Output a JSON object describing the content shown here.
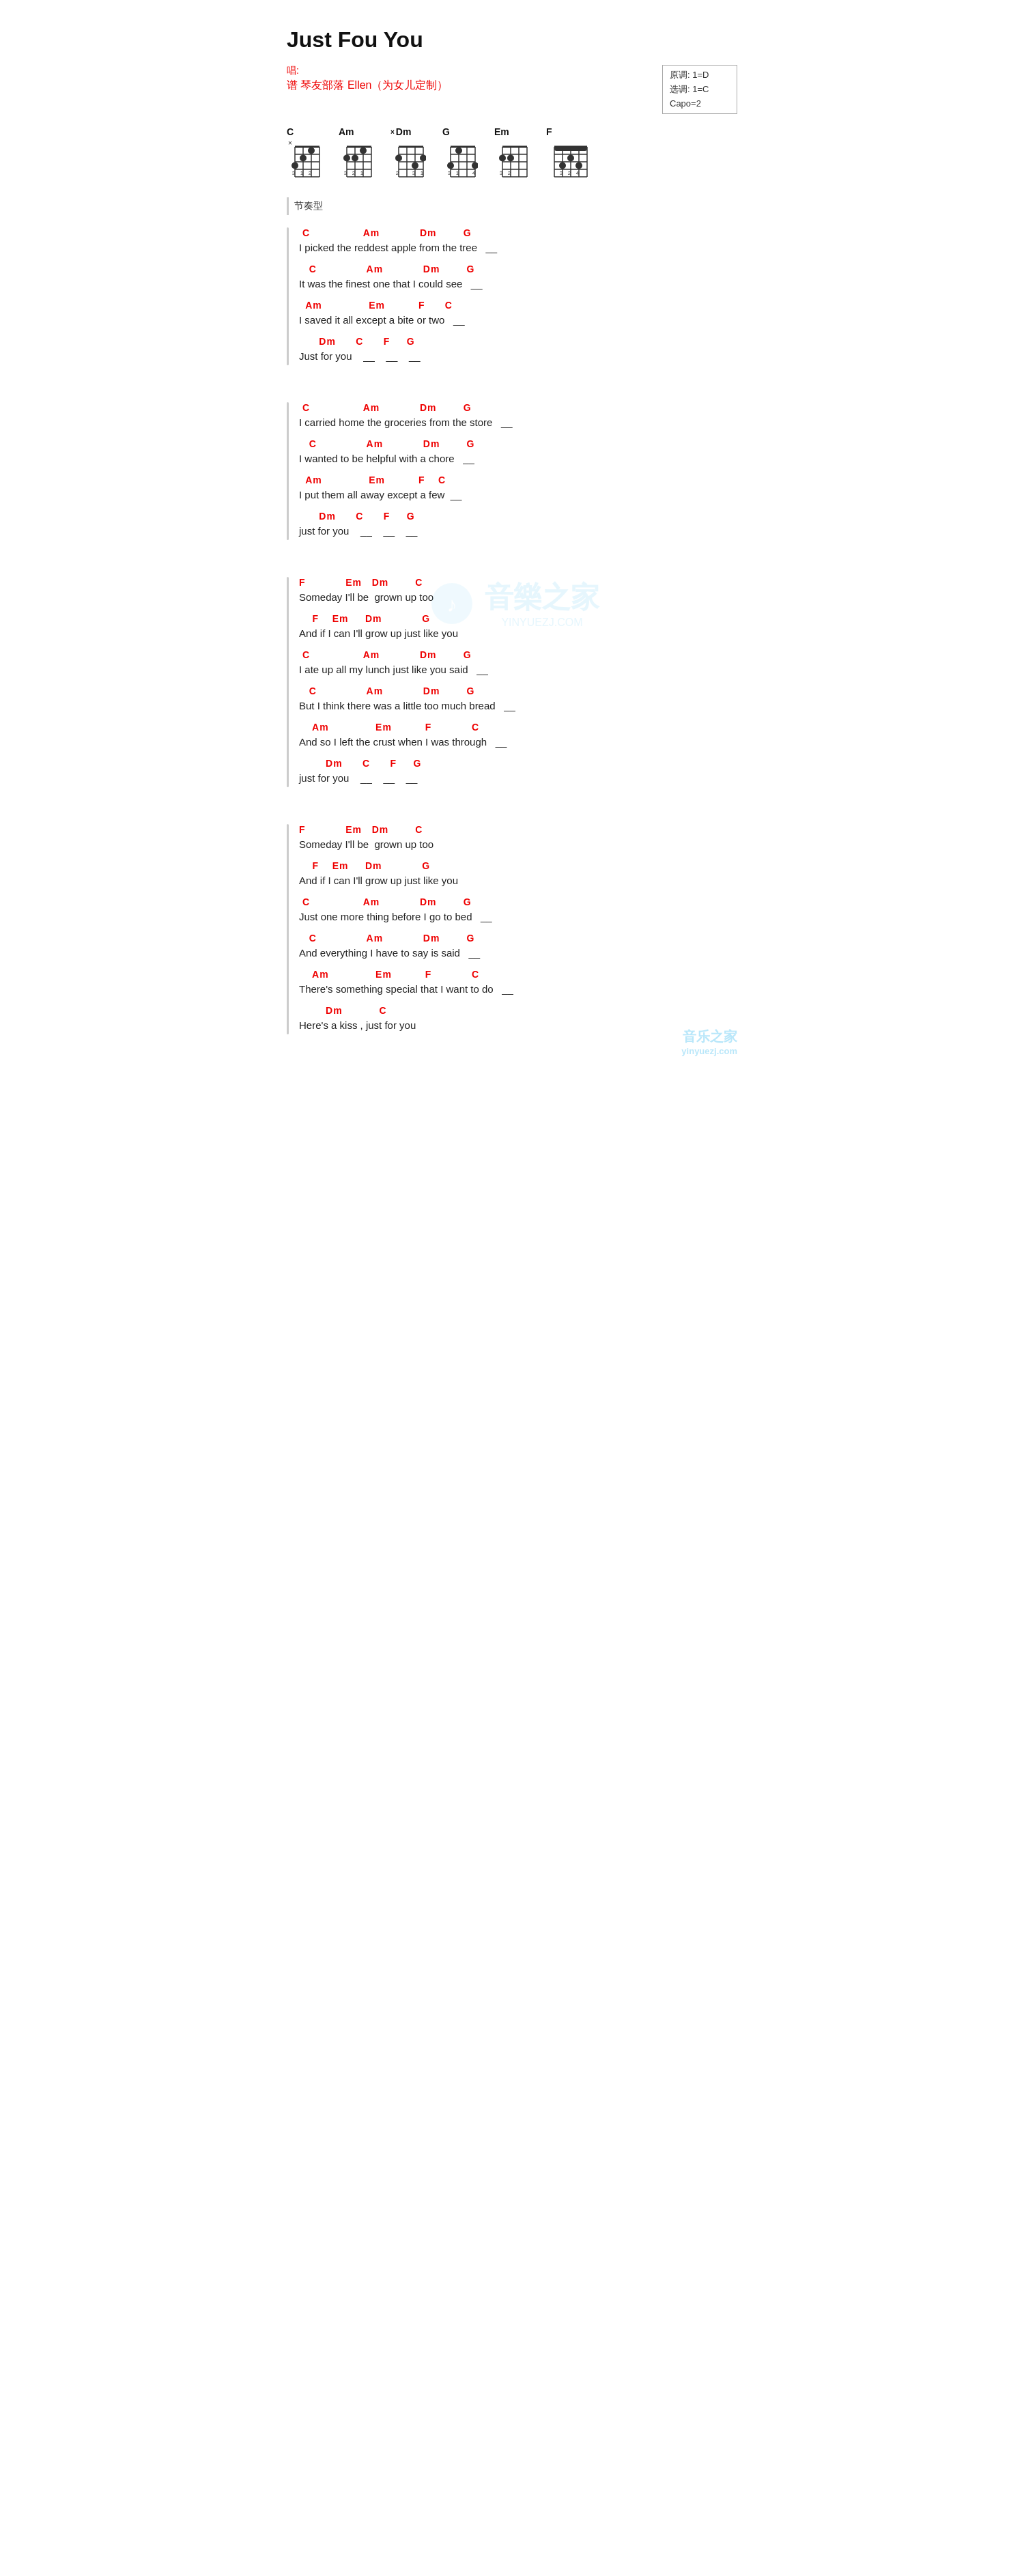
{
  "title": "Just Fou You",
  "meta": {
    "sing_label": "唱:",
    "composer_label": "谱",
    "composer": "琴友部落 Ellen（为女儿定制）",
    "original_key": "原调: 1=D",
    "selected_key": "选调: 1=C",
    "capo": "Capo=2"
  },
  "chords": [
    {
      "name": "C",
      "x_marker": true
    },
    {
      "name": "Am",
      "x_marker": false
    },
    {
      "name": "Dm",
      "x_marker": true
    },
    {
      "name": "G",
      "x_marker": false
    },
    {
      "name": "Em",
      "x_marker": false
    },
    {
      "name": "F",
      "x_marker": false
    }
  ],
  "rhythm_label": "节奏型",
  "sections": [
    {
      "lines": [
        {
          "type": "chord",
          "text": " C                Am            Dm        G"
        },
        {
          "type": "lyric",
          "text": "I picked the reddest apple from the tree    __"
        },
        {
          "type": "chord",
          "text": "   C               Am            Dm        G"
        },
        {
          "type": "lyric",
          "text": "It was the finest one that I could see    __"
        },
        {
          "type": "chord",
          "text": "  Am              Em          F      C"
        },
        {
          "type": "lyric",
          "text": "I saved it all except a bite or two    __"
        },
        {
          "type": "chord",
          "text": "      Dm      C      F     G"
        },
        {
          "type": "lyric",
          "text": "Just for you    __   __   __"
        }
      ]
    },
    {
      "lines": [
        {
          "type": "chord",
          "text": " C                Am            Dm        G"
        },
        {
          "type": "lyric",
          "text": "I carried home the groceries from the store    __"
        },
        {
          "type": "chord",
          "text": "   C               Am            Dm        G"
        },
        {
          "type": "lyric",
          "text": "I wanted to be helpful with a chore    __"
        },
        {
          "type": "chord",
          "text": "  Am              Em          F    C"
        },
        {
          "type": "lyric",
          "text": "I put them all away except a few  __"
        },
        {
          "type": "chord",
          "text": "      Dm      C      F     G"
        },
        {
          "type": "lyric",
          "text": "just for you    __   __   __"
        }
      ]
    },
    {
      "lines": [
        {
          "type": "chord",
          "text": "F            Em   Dm        C"
        },
        {
          "type": "lyric",
          "text": "Someday I'll be  grown up too"
        },
        {
          "type": "chord",
          "text": "    F    Em     Dm            G"
        },
        {
          "type": "lyric",
          "text": "And if I can I'll grow up just like you"
        },
        {
          "type": "chord",
          "text": " C                Am            Dm        G"
        },
        {
          "type": "lyric",
          "text": "I ate up all my lunch just like you said    __"
        },
        {
          "type": "chord",
          "text": "   C               Am            Dm        G"
        },
        {
          "type": "lyric",
          "text": "But I think there was a little too much bread    __"
        },
        {
          "type": "chord",
          "text": "    Am              Em          F            C"
        },
        {
          "type": "lyric",
          "text": "And so I left the crust when I was through    __"
        },
        {
          "type": "chord",
          "text": "        Dm      C      F     G"
        },
        {
          "type": "lyric",
          "text": "just for you    __   __   __"
        }
      ]
    },
    {
      "lines": [
        {
          "type": "chord",
          "text": "F            Em   Dm        C"
        },
        {
          "type": "lyric",
          "text": "Someday I'll be  grown up too"
        },
        {
          "type": "chord",
          "text": "    F    Em     Dm            G"
        },
        {
          "type": "lyric",
          "text": "And if I can I'll grow up just like you"
        },
        {
          "type": "chord",
          "text": " C                Am            Dm        G"
        },
        {
          "type": "lyric",
          "text": "Just one more thing before I go to bed    __"
        },
        {
          "type": "chord",
          "text": "   C               Am            Dm        G"
        },
        {
          "type": "lyric",
          "text": "And everything I have to say is said    __"
        },
        {
          "type": "chord",
          "text": "    Am              Em          F            C"
        },
        {
          "type": "lyric",
          "text": "There's something special that I want to do    __"
        },
        {
          "type": "chord",
          "text": "        Dm           C"
        },
        {
          "type": "lyric",
          "text": "Here's a kiss , just for you"
        }
      ]
    }
  ],
  "watermark": {
    "cn": "音樂之家",
    "en": "YINYUEZJ.COM"
  },
  "bottom_logo": {
    "cn": "音乐之家",
    "en": "yinyuezj.com"
  }
}
